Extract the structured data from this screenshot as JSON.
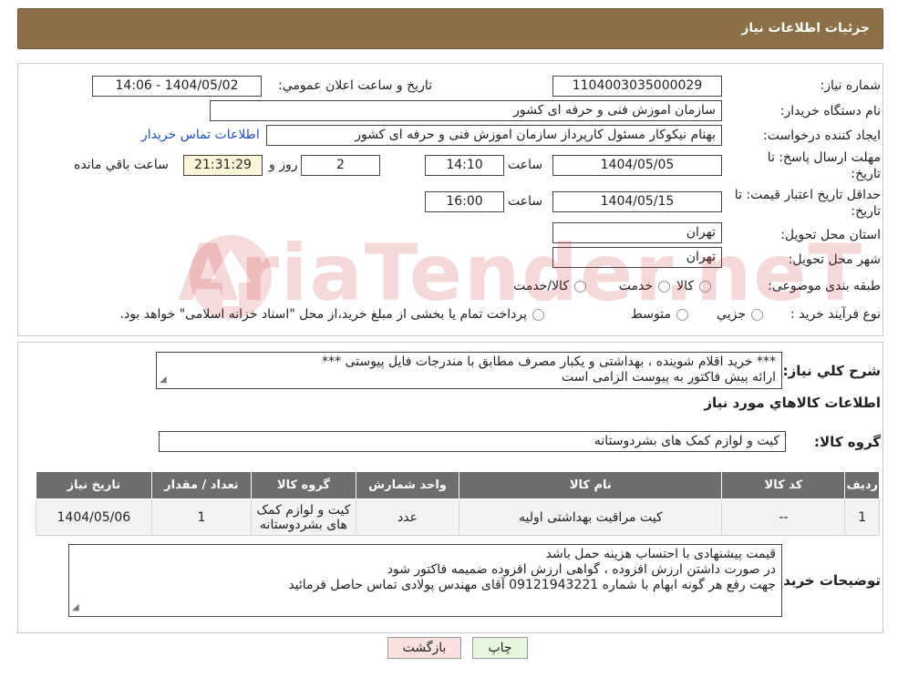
{
  "header": {
    "title": "جزئيات اطلاعات نياز"
  },
  "form": {
    "need_number_label": "شماره نياز:",
    "need_number": "1104003035000029",
    "announce_label": "تاريخ و ساعت اعلان عمومي:",
    "announce_value": "1404/05/02 - 14:06",
    "buyer_org_label": "نام دستگاه خريدار:",
    "buyer_org": "سازمان اموزش فنی و حرفه ای کشور",
    "creator_label": "ايجاد کننده درخواست:",
    "creator": "بهنام نیکوکار مسئول کارپرداز سازمان اموزش فنی و حرفه ای کشور",
    "contact_link": "اطلاعات تماس خريدار",
    "deadline_label_1": "مهلت ارسال پاسخ: تا",
    "deadline_label_2": "تاريخ:",
    "deadline_date": "1404/05/05",
    "time_label": "ساعت",
    "deadline_time": "14:10",
    "days_value": "2",
    "days_label": "روز و",
    "remaining_time": "21:31:29",
    "remaining_label": "ساعت باقي مانده",
    "price_validity_label_1": "حداقل تاريخ اعتبار قيمت: تا",
    "price_validity_label_2": "تاريخ:",
    "price_validity_date": "1404/05/15",
    "price_validity_time": "16:00",
    "province_label": "استان محل تحويل:",
    "province": "تهران",
    "city_label": "شهر محل تحويل:",
    "city": "تهران",
    "category_label": "طبقه بندی موضوعی:",
    "category_options": [
      "کالا",
      "خدمت",
      "کالا/خدمت"
    ],
    "process_label": "نوع فرآيند خريد :",
    "process_options": [
      "جزيي",
      "متوسط"
    ],
    "process_note": "پرداخت تمام یا بخشی از مبلغ خرید،از محل \"اسناد خزانه اسلامی\" خواهد بود."
  },
  "watermark": {
    "text": "AriaTender.neT"
  },
  "details": {
    "summary_label": "شرح کلي نياز:",
    "summary_line1": "*** خرید اقلام شوینده ، بهداشتی و یکبار مصرف مطابق با مندرجات فایل پیوستی ***",
    "summary_line2": "ارائه پیش فاکتور به پیوست الزامی است",
    "goods_info_title": "اطلاعات کالاهاي مورد نياز",
    "goods_group_label": "گروه کالا:",
    "goods_group": "کیت و لوازم کمک های بشردوستانه",
    "table": {
      "headers": [
        "رديف",
        "کد کالا",
        "نام کالا",
        "واحد شمارش",
        "گروه کالا",
        "تعداد / مقدار",
        "تاريخ نياز"
      ],
      "rows": [
        [
          "1",
          "--",
          "کیت مراقبت بهداشتی اولیه",
          "عدد",
          "کیت و لوازم کمک های بشردوستانه",
          "1",
          "1404/05/06"
        ]
      ]
    },
    "buyer_notes_label": "توضيحات خريدار:",
    "buyer_notes_line1": "قیمت پیشنهادی با احتساب هزینه حمل باشد",
    "buyer_notes_line2": "در صورت داشتن ارزش افزوده ، گواهی ارزش افزوده ضمیمه فاکتور شود",
    "buyer_notes_line3": "جهت رفع هر گونه ابهام با شماره 09121943221 آقای مهندس پولادی تماس حاصل فرمائید"
  },
  "buttons": {
    "print": "چاپ",
    "back": "بازگشت"
  },
  "colors": {
    "header": "#8b6f47",
    "table_header": "#6d6d6d",
    "link": "#1f4fbf"
  }
}
